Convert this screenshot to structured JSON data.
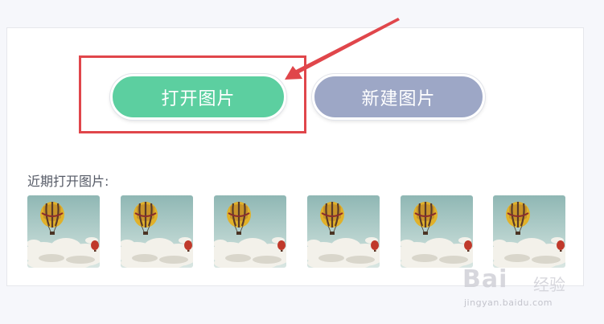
{
  "actions": {
    "open_label": "打开图片",
    "open_color": "#5ccfa0",
    "new_label": "新建图片",
    "new_color": "#9da7c6"
  },
  "recent": {
    "label": "近期打开图片:",
    "thumbnails": [
      {
        "icon": "hot-air-balloon-image"
      },
      {
        "icon": "hot-air-balloon-image"
      },
      {
        "icon": "hot-air-balloon-image"
      },
      {
        "icon": "hot-air-balloon-image"
      },
      {
        "icon": "hot-air-balloon-image"
      },
      {
        "icon": "hot-air-balloon-image"
      }
    ]
  },
  "annotation": {
    "color": "#e0464b"
  },
  "watermark": {
    "brand": "Bai",
    "brand_suffix": "经验",
    "url": "jingyan.baidu.com"
  }
}
